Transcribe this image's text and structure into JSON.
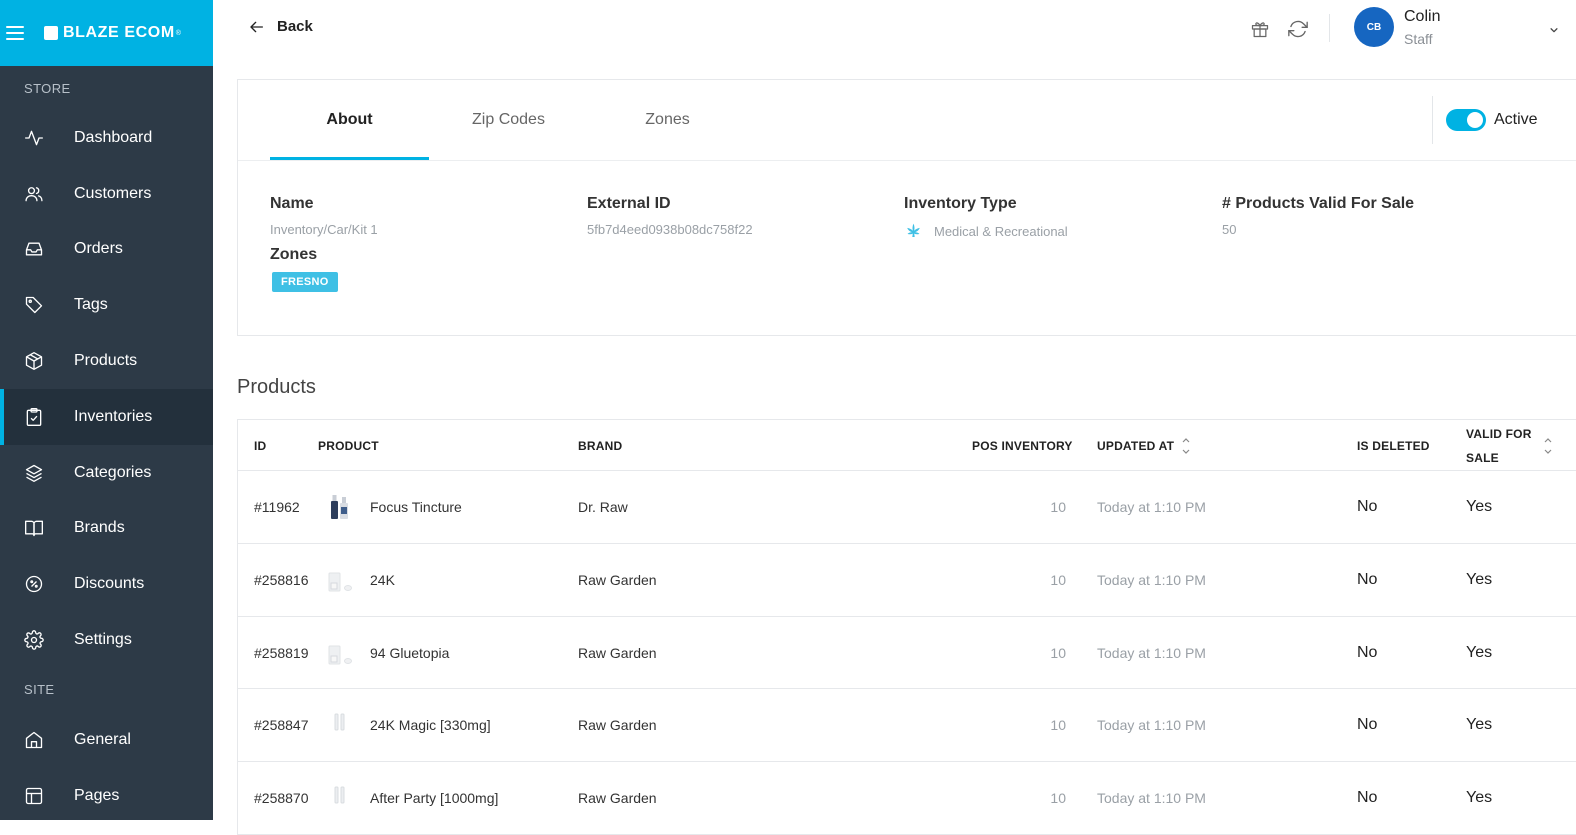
{
  "brand": {
    "name": "BLAZE ECOM",
    "mark": "®"
  },
  "sidebar": {
    "store_label": "STORE",
    "site_label": "SITE",
    "items": [
      {
        "label": "Dashboard",
        "icon": "activity-icon"
      },
      {
        "label": "Customers",
        "icon": "users-icon"
      },
      {
        "label": "Orders",
        "icon": "inbox-icon"
      },
      {
        "label": "Tags",
        "icon": "tag-icon"
      },
      {
        "label": "Products",
        "icon": "box-icon"
      },
      {
        "label": "Inventories",
        "icon": "clipboard-check-icon"
      },
      {
        "label": "Categories",
        "icon": "layers-icon"
      },
      {
        "label": "Brands",
        "icon": "book-open-icon"
      },
      {
        "label": "Discounts",
        "icon": "percent-icon"
      },
      {
        "label": "Settings",
        "icon": "gear-icon"
      }
    ],
    "site_items": [
      {
        "label": "General",
        "icon": "home-icon"
      },
      {
        "label": "Pages",
        "icon": "layout-icon"
      }
    ]
  },
  "header": {
    "back_label": "Back",
    "user": {
      "initials": "CB",
      "name": "Colin",
      "role": "Staff"
    }
  },
  "detail": {
    "tabs": [
      "About",
      "Zip Codes",
      "Zones"
    ],
    "active_label": "Active",
    "fields": {
      "name_label": "Name",
      "name_value": "Inventory/Car/Kit 1",
      "external_id_label": "External ID",
      "external_id_value": "5fb7d4eed0938b08dc758f22",
      "inventory_type_label": "Inventory Type",
      "inventory_type_value": "Medical & Recreational",
      "valid_label": "# Products Valid For Sale",
      "valid_value": "50",
      "zones_label": "Zones",
      "zone_badge": "FRESNO"
    }
  },
  "products": {
    "title": "Products",
    "columns": {
      "id": "ID",
      "product": "PRODUCT",
      "brand": "BRAND",
      "pos": "POS INVENTORY",
      "updated": "UPDATED AT",
      "deleted": "IS DELETED",
      "valid_1": "VALID FOR",
      "valid_2": "SALE"
    },
    "rows": [
      {
        "id": "#11962",
        "product": "Focus Tincture",
        "brand": "Dr. Raw",
        "pos": "10",
        "updated": "Today at 1:10 PM",
        "deleted": "No",
        "valid": "Yes"
      },
      {
        "id": "#258816",
        "product": "24K",
        "brand": "Raw Garden",
        "pos": "10",
        "updated": "Today at 1:10 PM",
        "deleted": "No",
        "valid": "Yes"
      },
      {
        "id": "#258819",
        "product": "94 Gluetopia",
        "brand": "Raw Garden",
        "pos": "10",
        "updated": "Today at 1:10 PM",
        "deleted": "No",
        "valid": "Yes"
      },
      {
        "id": "#258847",
        "product": "24K Magic [330mg]",
        "brand": "Raw Garden",
        "pos": "10",
        "updated": "Today at 1:10 PM",
        "deleted": "No",
        "valid": "Yes"
      },
      {
        "id": "#258870",
        "product": "After Party [1000mg]",
        "brand": "Raw Garden",
        "pos": "10",
        "updated": "Today at 1:10 PM",
        "deleted": "No",
        "valid": "Yes"
      }
    ]
  }
}
